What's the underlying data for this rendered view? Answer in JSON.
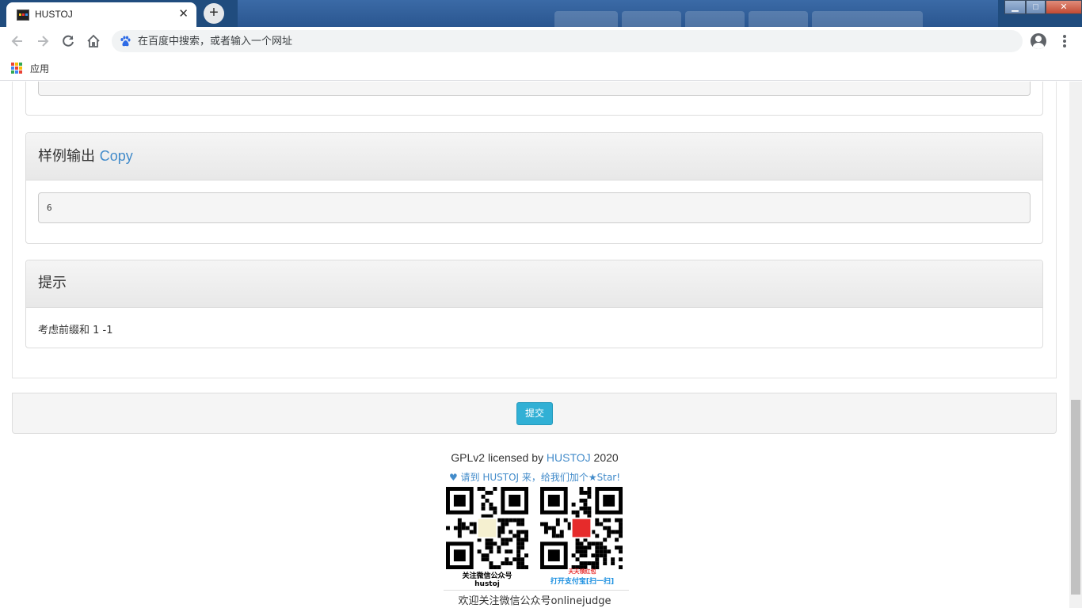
{
  "browser": {
    "tab_title": "HUSTOJ",
    "tab_close": "✕",
    "new_tab": "+",
    "omnibox_placeholder": "在百度中搜索，或者输入一个网址",
    "bookmarks": {
      "apps_label": "应用"
    },
    "window_buttons": {
      "minimize": "▁",
      "maximize": "□",
      "close": "✕"
    }
  },
  "page": {
    "sample_output": {
      "heading": "样例输出",
      "copy_label": "Copy",
      "value": "6"
    },
    "hint": {
      "heading": "提示",
      "text": "考虑前缀和 1  -1"
    },
    "submit_label": "提交",
    "footer": {
      "license_prefix": "GPLv2 licensed by ",
      "license_link": "HUSTOJ",
      "license_year": " 2020",
      "star_text": "♥ 请到 HUSTOJ 来，给我们加个★Star!",
      "qr_left_caption_1": "关注微信公众号",
      "qr_left_caption_2": "hustoj",
      "qr_right_caption_1": "天天领红包",
      "qr_right_caption_2": "打开支付宝[扫一扫]",
      "welcome": "欢迎关注微信公众号onlinejudge"
    }
  },
  "colors": {
    "link": "#428bca",
    "submit_button": "#31b0d5",
    "panel_heading": "#e8e8e8",
    "redpacket": "#e62b2b"
  },
  "icons": [
    "back-icon",
    "forward-icon",
    "reload-icon",
    "home-icon",
    "baidu-paw-icon",
    "profile-icon",
    "menu-icon",
    "apps-grid-icon",
    "heart-icon",
    "qr-code-icon"
  ]
}
